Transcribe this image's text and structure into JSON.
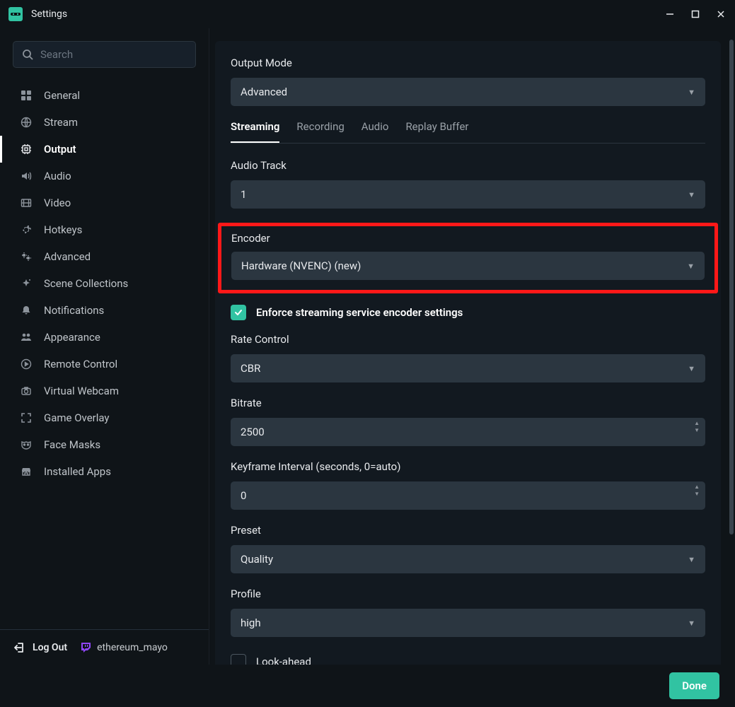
{
  "titlebar": {
    "title": "Settings"
  },
  "search": {
    "placeholder": "Search"
  },
  "nav": {
    "items": [
      {
        "id": "general",
        "label": "General",
        "icon": "grid"
      },
      {
        "id": "stream",
        "label": "Stream",
        "icon": "globe"
      },
      {
        "id": "output",
        "label": "Output",
        "icon": "chip",
        "active": true
      },
      {
        "id": "audio",
        "label": "Audio",
        "icon": "volume"
      },
      {
        "id": "video",
        "label": "Video",
        "icon": "film"
      },
      {
        "id": "hotkeys",
        "label": "Hotkeys",
        "icon": "gear"
      },
      {
        "id": "advanced",
        "label": "Advanced",
        "icon": "gears"
      },
      {
        "id": "scene-collections",
        "label": "Scene Collections",
        "icon": "sparkle"
      },
      {
        "id": "notifications",
        "label": "Notifications",
        "icon": "bell"
      },
      {
        "id": "appearance",
        "label": "Appearance",
        "icon": "people"
      },
      {
        "id": "remote-control",
        "label": "Remote Control",
        "icon": "play"
      },
      {
        "id": "virtual-webcam",
        "label": "Virtual Webcam",
        "icon": "camera"
      },
      {
        "id": "game-overlay",
        "label": "Game Overlay",
        "icon": "expand"
      },
      {
        "id": "face-masks",
        "label": "Face Masks",
        "icon": "mask"
      },
      {
        "id": "installed-apps",
        "label": "Installed Apps",
        "icon": "store"
      }
    ]
  },
  "bottom": {
    "logout": "Log Out",
    "username": "ethereum_mayo"
  },
  "panel": {
    "output_mode": {
      "label": "Output Mode",
      "value": "Advanced"
    },
    "tabs": [
      "Streaming",
      "Recording",
      "Audio",
      "Replay Buffer"
    ],
    "active_tab": 0,
    "audio_track": {
      "label": "Audio Track",
      "value": "1"
    },
    "encoder": {
      "label": "Encoder",
      "value": "Hardware (NVENC) (new)"
    },
    "enforce": {
      "label": "Enforce streaming service encoder settings",
      "checked": true
    },
    "rate_control": {
      "label": "Rate Control",
      "value": "CBR"
    },
    "bitrate": {
      "label": "Bitrate",
      "value": "2500"
    },
    "keyframe": {
      "label": "Keyframe Interval (seconds, 0=auto)",
      "value": "0"
    },
    "preset": {
      "label": "Preset",
      "value": "Quality"
    },
    "profile": {
      "label": "Profile",
      "value": "high"
    },
    "lookahead": {
      "label": "Look-ahead",
      "checked": false
    }
  },
  "footer": {
    "done": "Done"
  }
}
